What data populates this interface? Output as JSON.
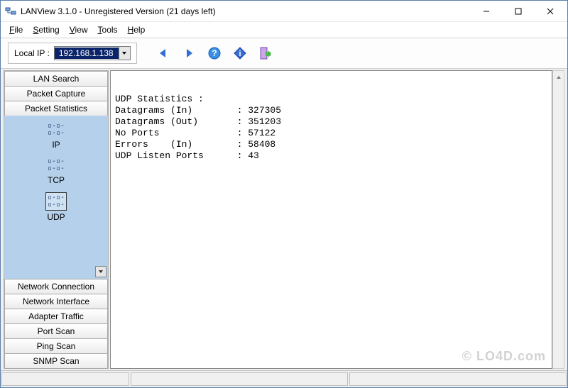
{
  "title": "LANView 3.1.0 - Unregistered Version (21 days left)",
  "menu": {
    "file": "File",
    "setting": "Setting",
    "view": "View",
    "tools": "Tools",
    "help": "Help"
  },
  "toolbar": {
    "local_ip_label": "Local IP :",
    "ip_value": "192.168.1.138"
  },
  "sidebar": {
    "top_buttons": [
      "LAN Search",
      "Packet Capture",
      "Packet Statistics"
    ],
    "protocols": [
      {
        "label": "IP",
        "selected": false
      },
      {
        "label": "TCP",
        "selected": false
      },
      {
        "label": "UDP",
        "selected": true
      }
    ],
    "bottom_buttons": [
      "Network Connection",
      "Network Interface",
      "Adapter Traffic",
      "Port Scan",
      "Ping Scan",
      "SNMP Scan"
    ]
  },
  "stats": {
    "header": "UDP Statistics :",
    "rows": [
      {
        "label": "Datagrams (In)",
        "value": "327305"
      },
      {
        "label": "Datagrams (Out)",
        "value": "351203"
      },
      {
        "label": "No Ports",
        "value": "57122"
      },
      {
        "label": "Errors    (In)",
        "value": "58408"
      },
      {
        "label": "UDP Listen Ports",
        "value": "43"
      }
    ]
  },
  "watermark": "© LO4D.com"
}
